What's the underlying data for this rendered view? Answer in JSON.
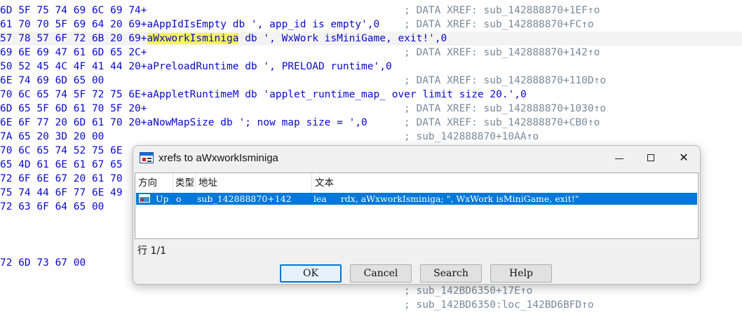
{
  "listing": [
    {
      "code": "6D 5F 75 74 69 6C 69 74+",
      "comment": "; DATA XREF: sub_142888870+1EF↑o"
    },
    {
      "code": "61 70 70 5F 69 64 20 69+aAppIdIsEmpty db ', app_id is empty',0",
      "comment": "; DATA XREF: sub_142888870+FC↑o"
    },
    {
      "pre": "57 78 57 6F 72 6B 20 69+",
      "sym": "aWxworkIsminiga",
      "post": " db ', WxWork isMiniGame, exit!',0",
      "highlighted": true
    },
    {
      "code": "69 6E 69 47 61 6D 65 2C+",
      "comment": "; DATA XREF: sub_142888870+142↑o"
    },
    {
      "code": "50 52 45 4C 4F 41 44 20+aPreloadRuntime db ', PRELOAD runtime',0",
      "comment": ""
    },
    {
      "code": "6E 74 69 6D 65 00",
      "comment": "; DATA XREF: sub_142888870+110D↑o"
    },
    {
      "code": "70 6C 65 74 5F 72 75 6E+aAppletRuntimeM db 'applet_runtime_map_ over limit size 20.',0",
      "comment": ""
    },
    {
      "code": "6D 65 5F 6D 61 70 5F 20+",
      "comment": "; DATA XREF: sub_142888870+1030↑o"
    },
    {
      "code": "6E 6F 77 20 6D 61 70 20+aNowMapSize db '; now map size = ',0",
      "comment": "; DATA XREF: sub_142888870+CB0↑o"
    },
    {
      "code": "7A 65 20 3D 20 00",
      "comment": "; sub_142888870+10AA↑o"
    },
    {
      "code": "70 6C 65 74 52 75 6E",
      "comment": ""
    },
    {
      "code": "65 4D 61 6E 61 67 65",
      "comment": ""
    },
    {
      "code": "72 6F 6E 67 20 61 70",
      "comment": ""
    },
    {
      "code": "75 74 44 6F 77 6E 49",
      "comment": ""
    },
    {
      "code": "72 63 6F 64 65 00",
      "comment": ""
    },
    {
      "code": "72 6D 73 67 00",
      "comment": ""
    },
    {
      "code": "",
      "comment": "; sub_142BD6350+17E↑o"
    },
    {
      "code": "",
      "comment": "; sub_142BD6350:loc_142BD6BFD↑o"
    }
  ],
  "dialog": {
    "title": "xrefs to aWxworkIsminiga",
    "columns": [
      "方向",
      "类型",
      "地址",
      "文本"
    ],
    "rows": [
      {
        "direction": "Up",
        "type": "o",
        "address": "sub_142888870+142",
        "text": "lea     rdx, aWxworkIsminiga; \", WxWork isMiniGame, exit!\""
      }
    ],
    "status": "行 1/1",
    "buttons": {
      "ok": "OK",
      "cancel": "Cancel",
      "search": "Search",
      "help": "Help"
    }
  },
  "colors": {
    "selection": "#0078d7",
    "highlight": "#f5f55a",
    "code": "#0a0ac8",
    "comment": "#7a8a9a"
  }
}
